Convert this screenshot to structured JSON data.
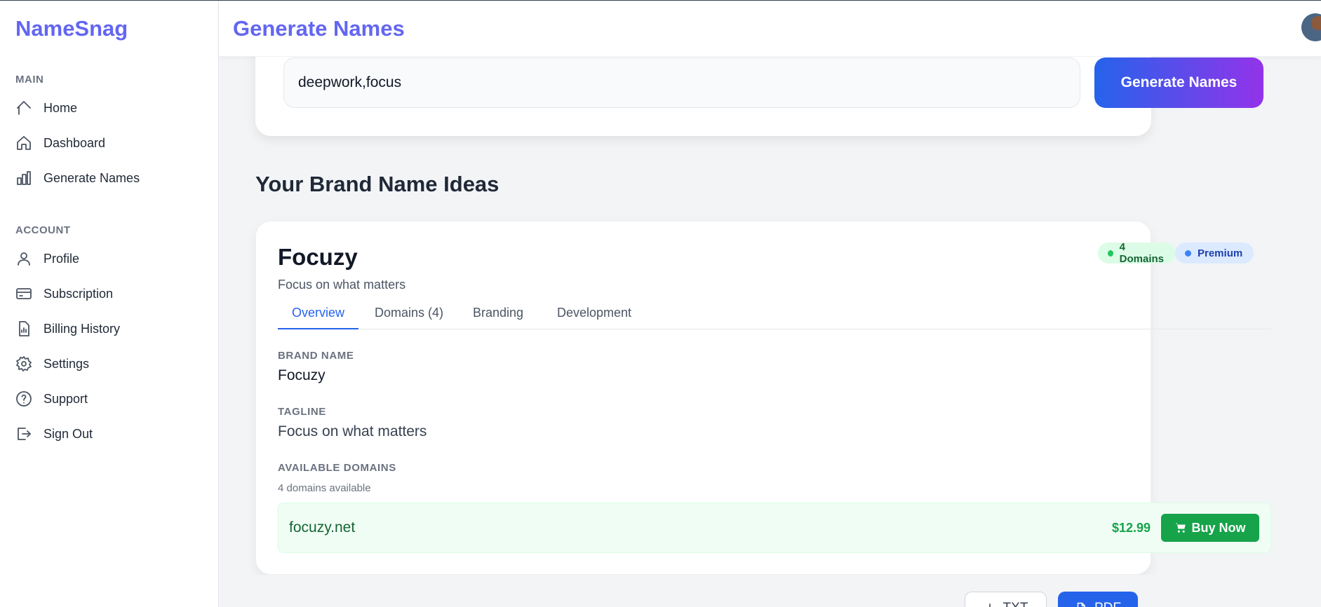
{
  "app": {
    "name": "NameSnag"
  },
  "sidebar": {
    "sections": [
      {
        "label": "MAIN",
        "items": [
          {
            "label": "Home",
            "icon": "home-icon"
          },
          {
            "label": "Dashboard",
            "icon": "house-icon"
          },
          {
            "label": "Generate Names",
            "icon": "bar-chart-icon"
          }
        ]
      },
      {
        "label": "ACCOUNT",
        "items": [
          {
            "label": "Profile",
            "icon": "user-icon"
          },
          {
            "label": "Subscription",
            "icon": "credit-card-icon"
          },
          {
            "label": "Billing History",
            "icon": "receipt-icon"
          },
          {
            "label": "Settings",
            "icon": "gear-icon"
          },
          {
            "label": "Support",
            "icon": "help-circle-icon"
          },
          {
            "label": "Sign Out",
            "icon": "sign-out-icon"
          }
        ]
      }
    ]
  },
  "header": {
    "title": "Generate Names"
  },
  "search": {
    "value": "deepwork,focus",
    "button_label": "Generate Names"
  },
  "results": {
    "title": "Your Brand Name Ideas"
  },
  "card": {
    "name": "Focuzy",
    "tagline": "Focus on what matters",
    "badges": {
      "domains": "4 Domains",
      "tier": "Premium"
    },
    "tabs": [
      "Overview",
      "Domains (4)",
      "Branding",
      "Development"
    ],
    "active_tab": "Overview",
    "fields": {
      "brand_name_label": "BRAND NAME",
      "brand_name_value": "Focuzy",
      "tagline_label": "TAGLINE",
      "tagline_value": "Focus on what matters",
      "domains_label": "AVAILABLE DOMAINS",
      "domains_note": "4 domains available"
    },
    "domain": {
      "name": "focuzy.net",
      "price": "$12.99",
      "buy_label": "Buy Now"
    }
  },
  "export": {
    "txt_label": "TXT",
    "pdf_label": "PDF"
  },
  "colors": {
    "brand": "#6366f1",
    "primary": "#2563eb",
    "success": "#16a34a",
    "gradient_end": "#9333ea"
  }
}
